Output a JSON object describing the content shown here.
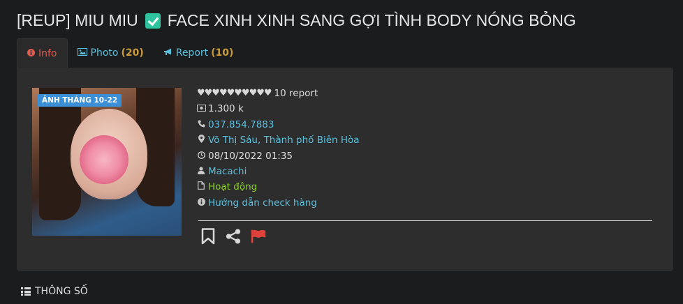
{
  "header": {
    "title_prefix": "[REUP] MIU MIU",
    "title_suffix": "FACE XINH XINH SANG GỢI TÌNH BODY NÓNG BỎNG",
    "check_icon": "check-box-icon"
  },
  "tabs": [
    {
      "label": "Info",
      "count": "",
      "icon": "info-icon",
      "active": true
    },
    {
      "label": "Photo",
      "count": "(20)",
      "icon": "image-icon",
      "active": false
    },
    {
      "label": "Report",
      "count": "(10)",
      "icon": "bullhorn-icon",
      "active": false
    }
  ],
  "profile": {
    "badge": "ẢNH THÁNG 10-22",
    "hearts": "♥♥♥♥♥♥♥♥♥♥",
    "report_text": "10 report",
    "price": "1.300 k",
    "phone": "037.854.7883",
    "location": "Võ Thị Sáu, Thành phố Biên Hòa",
    "date": "08/10/2022 01:35",
    "user": "Macachi",
    "status": "Hoạt động",
    "guide": "Hướng dẫn check hàng"
  },
  "colors": {
    "background": "#1b1c1d",
    "panel": "#2d2d2d",
    "link": "#5bc0de",
    "active_tab": "#e05a4f",
    "count": "#c99a3c",
    "status": "#8ccf2c",
    "flag": "#e0413a"
  },
  "footer": {
    "label": "THÔNG SỐ"
  }
}
